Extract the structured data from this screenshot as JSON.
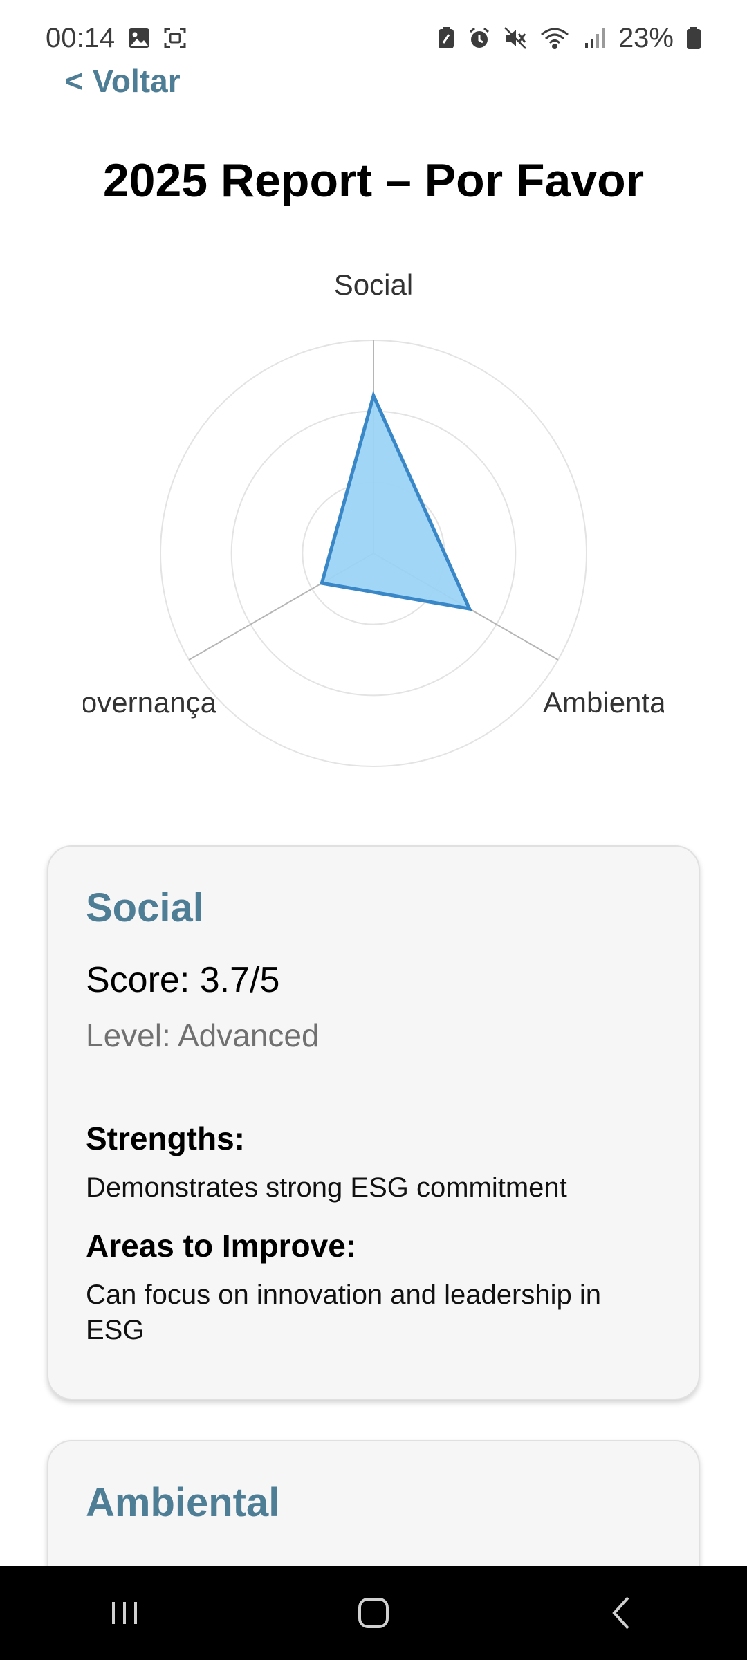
{
  "status_bar": {
    "time": "00:14",
    "battery": "23%",
    "left_icons": [
      "image-icon",
      "screenshot-icon"
    ],
    "right_icons": [
      "battery-saver-icon",
      "alarm-icon",
      "mute-icon",
      "wifi-icon",
      "signal-icon",
      "battery-icon"
    ]
  },
  "header": {
    "back_label": "< Voltar",
    "title": "2025 Report – Por Favor"
  },
  "chart_data": {
    "type": "radar",
    "axes": [
      "Social",
      "Ambiental",
      "Governança"
    ],
    "axis_labels_visible": [
      "Social",
      "Ambienta",
      "overnança"
    ],
    "values": [
      3.7,
      2.6,
      1.4
    ],
    "scale_max": 5,
    "rings": 3,
    "fill_color": "#9dd4f5",
    "stroke_color": "#3a87c8"
  },
  "cards": [
    {
      "title": "Social",
      "score": "Score: 3.7/5",
      "level": "Level: Advanced",
      "strengths_heading": "Strengths:",
      "strengths_text": "Demonstrates strong ESG commitment",
      "improve_heading": "Areas to Improve:",
      "improve_text": "Can focus on innovation and leadership in ESG"
    },
    {
      "title": "Ambiental"
    }
  ],
  "colors": {
    "accent": "#4e7d96",
    "card_bg": "#f6f6f6",
    "nav_bg": "#000000"
  },
  "nav": {
    "buttons": [
      "recent-apps-icon",
      "home-icon",
      "back-icon"
    ]
  }
}
